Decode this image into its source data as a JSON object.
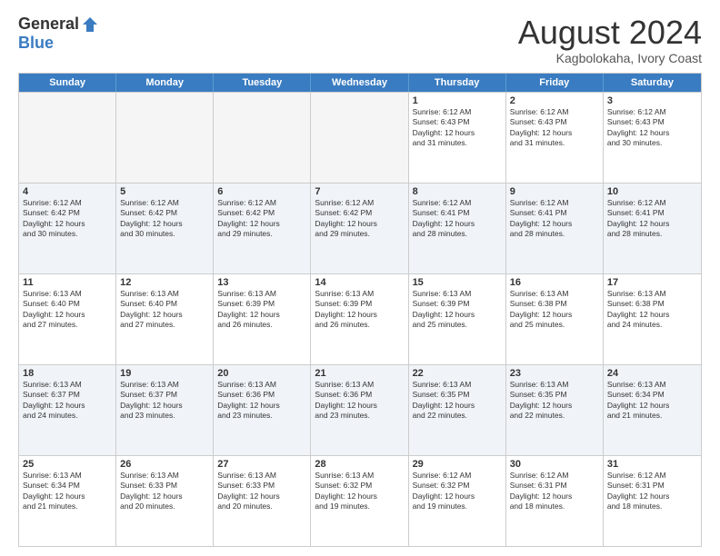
{
  "logo": {
    "general": "General",
    "blue": "Blue"
  },
  "title": "August 2024",
  "subtitle": "Kagbolokaha, Ivory Coast",
  "header_days": [
    "Sunday",
    "Monday",
    "Tuesday",
    "Wednesday",
    "Thursday",
    "Friday",
    "Saturday"
  ],
  "weeks": [
    [
      {
        "day": "",
        "info": "",
        "empty": true
      },
      {
        "day": "",
        "info": "",
        "empty": true
      },
      {
        "day": "",
        "info": "",
        "empty": true
      },
      {
        "day": "",
        "info": "",
        "empty": true
      },
      {
        "day": "1",
        "info": "Sunrise: 6:12 AM\nSunset: 6:43 PM\nDaylight: 12 hours\nand 31 minutes.",
        "empty": false
      },
      {
        "day": "2",
        "info": "Sunrise: 6:12 AM\nSunset: 6:43 PM\nDaylight: 12 hours\nand 31 minutes.",
        "empty": false
      },
      {
        "day": "3",
        "info": "Sunrise: 6:12 AM\nSunset: 6:43 PM\nDaylight: 12 hours\nand 30 minutes.",
        "empty": false
      }
    ],
    [
      {
        "day": "4",
        "info": "Sunrise: 6:12 AM\nSunset: 6:42 PM\nDaylight: 12 hours\nand 30 minutes.",
        "empty": false
      },
      {
        "day": "5",
        "info": "Sunrise: 6:12 AM\nSunset: 6:42 PM\nDaylight: 12 hours\nand 30 minutes.",
        "empty": false
      },
      {
        "day": "6",
        "info": "Sunrise: 6:12 AM\nSunset: 6:42 PM\nDaylight: 12 hours\nand 29 minutes.",
        "empty": false
      },
      {
        "day": "7",
        "info": "Sunrise: 6:12 AM\nSunset: 6:42 PM\nDaylight: 12 hours\nand 29 minutes.",
        "empty": false
      },
      {
        "day": "8",
        "info": "Sunrise: 6:12 AM\nSunset: 6:41 PM\nDaylight: 12 hours\nand 28 minutes.",
        "empty": false
      },
      {
        "day": "9",
        "info": "Sunrise: 6:12 AM\nSunset: 6:41 PM\nDaylight: 12 hours\nand 28 minutes.",
        "empty": false
      },
      {
        "day": "10",
        "info": "Sunrise: 6:12 AM\nSunset: 6:41 PM\nDaylight: 12 hours\nand 28 minutes.",
        "empty": false
      }
    ],
    [
      {
        "day": "11",
        "info": "Sunrise: 6:13 AM\nSunset: 6:40 PM\nDaylight: 12 hours\nand 27 minutes.",
        "empty": false
      },
      {
        "day": "12",
        "info": "Sunrise: 6:13 AM\nSunset: 6:40 PM\nDaylight: 12 hours\nand 27 minutes.",
        "empty": false
      },
      {
        "day": "13",
        "info": "Sunrise: 6:13 AM\nSunset: 6:39 PM\nDaylight: 12 hours\nand 26 minutes.",
        "empty": false
      },
      {
        "day": "14",
        "info": "Sunrise: 6:13 AM\nSunset: 6:39 PM\nDaylight: 12 hours\nand 26 minutes.",
        "empty": false
      },
      {
        "day": "15",
        "info": "Sunrise: 6:13 AM\nSunset: 6:39 PM\nDaylight: 12 hours\nand 25 minutes.",
        "empty": false
      },
      {
        "day": "16",
        "info": "Sunrise: 6:13 AM\nSunset: 6:38 PM\nDaylight: 12 hours\nand 25 minutes.",
        "empty": false
      },
      {
        "day": "17",
        "info": "Sunrise: 6:13 AM\nSunset: 6:38 PM\nDaylight: 12 hours\nand 24 minutes.",
        "empty": false
      }
    ],
    [
      {
        "day": "18",
        "info": "Sunrise: 6:13 AM\nSunset: 6:37 PM\nDaylight: 12 hours\nand 24 minutes.",
        "empty": false
      },
      {
        "day": "19",
        "info": "Sunrise: 6:13 AM\nSunset: 6:37 PM\nDaylight: 12 hours\nand 23 minutes.",
        "empty": false
      },
      {
        "day": "20",
        "info": "Sunrise: 6:13 AM\nSunset: 6:36 PM\nDaylight: 12 hours\nand 23 minutes.",
        "empty": false
      },
      {
        "day": "21",
        "info": "Sunrise: 6:13 AM\nSunset: 6:36 PM\nDaylight: 12 hours\nand 23 minutes.",
        "empty": false
      },
      {
        "day": "22",
        "info": "Sunrise: 6:13 AM\nSunset: 6:35 PM\nDaylight: 12 hours\nand 22 minutes.",
        "empty": false
      },
      {
        "day": "23",
        "info": "Sunrise: 6:13 AM\nSunset: 6:35 PM\nDaylight: 12 hours\nand 22 minutes.",
        "empty": false
      },
      {
        "day": "24",
        "info": "Sunrise: 6:13 AM\nSunset: 6:34 PM\nDaylight: 12 hours\nand 21 minutes.",
        "empty": false
      }
    ],
    [
      {
        "day": "25",
        "info": "Sunrise: 6:13 AM\nSunset: 6:34 PM\nDaylight: 12 hours\nand 21 minutes.",
        "empty": false
      },
      {
        "day": "26",
        "info": "Sunrise: 6:13 AM\nSunset: 6:33 PM\nDaylight: 12 hours\nand 20 minutes.",
        "empty": false
      },
      {
        "day": "27",
        "info": "Sunrise: 6:13 AM\nSunset: 6:33 PM\nDaylight: 12 hours\nand 20 minutes.",
        "empty": false
      },
      {
        "day": "28",
        "info": "Sunrise: 6:13 AM\nSunset: 6:32 PM\nDaylight: 12 hours\nand 19 minutes.",
        "empty": false
      },
      {
        "day": "29",
        "info": "Sunrise: 6:12 AM\nSunset: 6:32 PM\nDaylight: 12 hours\nand 19 minutes.",
        "empty": false
      },
      {
        "day": "30",
        "info": "Sunrise: 6:12 AM\nSunset: 6:31 PM\nDaylight: 12 hours\nand 18 minutes.",
        "empty": false
      },
      {
        "day": "31",
        "info": "Sunrise: 6:12 AM\nSunset: 6:31 PM\nDaylight: 12 hours\nand 18 minutes.",
        "empty": false
      }
    ]
  ]
}
